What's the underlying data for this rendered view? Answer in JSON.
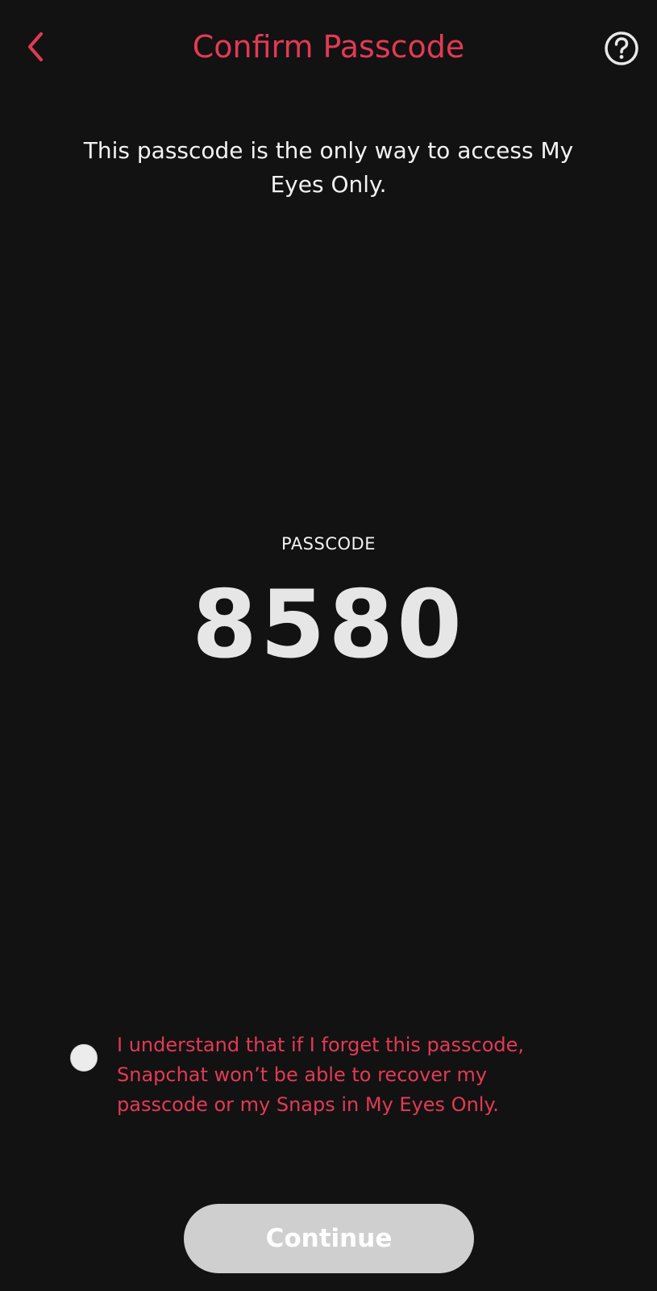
{
  "header": {
    "title": "Confirm Passcode",
    "back_icon": "chevron-left-icon",
    "help_icon": "question-circle-icon"
  },
  "subtitle": "This passcode is the only way to access My\nEyes Only.",
  "passcode": {
    "label": "PASSCODE",
    "value": "8580"
  },
  "acknowledgement": {
    "checked": false,
    "text": "I understand that if I forget this passcode,\nSnapchat won’t be able to recover my\npasscode or my Snaps in My Eyes Only."
  },
  "continue_button": {
    "label": "Continue",
    "enabled": false
  },
  "colors": {
    "background": "#121212",
    "accent": "#e23a55",
    "text": "#f2f2f2",
    "disabled_button": "#cfcfcf"
  }
}
